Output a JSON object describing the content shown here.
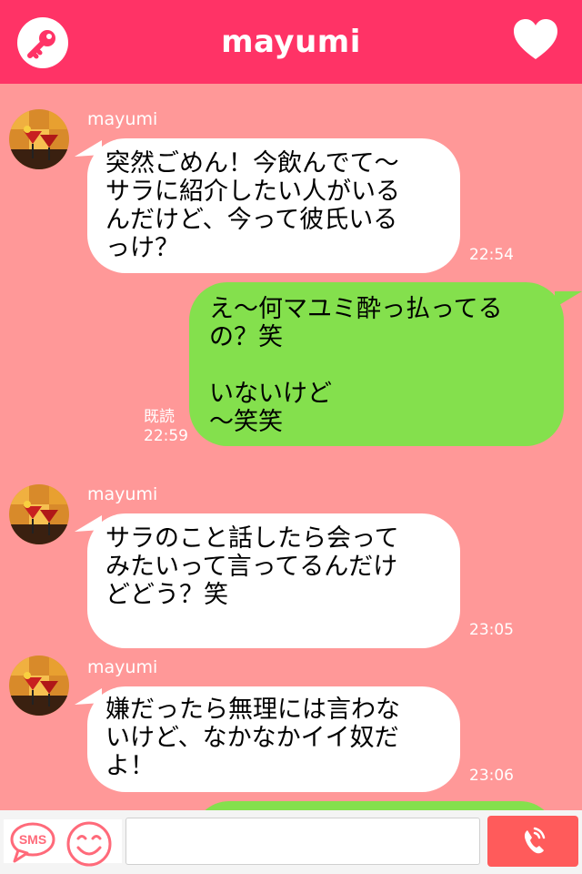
{
  "header": {
    "title": "mayumi"
  },
  "messages": [
    {
      "sender": "mayumi",
      "text": "突然ごめん！今飲んでて〜\nサラに紹介したい人がいる\nんだけど、今って彼氏いる\nっけ？",
      "time": "22:54"
    },
    {
      "text": "え〜何マユミ酔っ払ってる\nの？笑\n\nいないけど\n〜笑笑",
      "read": "既読",
      "time": "22:59"
    },
    {
      "sender": "mayumi",
      "text": "サラのこと話したら会って\nみたいって言ってるんだけ\nどどう？笑",
      "time": "23:05"
    },
    {
      "sender": "mayumi",
      "text": "嫌だったら無理には言わな\nいけど、なかなかイイ奴だ\nよ！",
      "time": "23:06"
    }
  ],
  "footer": {
    "sms_label": "SMS",
    "input_placeholder": ""
  },
  "colors": {
    "header": "#ff3366",
    "background": "#ff9898",
    "incoming": "#ffffff",
    "outgoing": "#84e04d",
    "call": "#ff5b5b"
  }
}
